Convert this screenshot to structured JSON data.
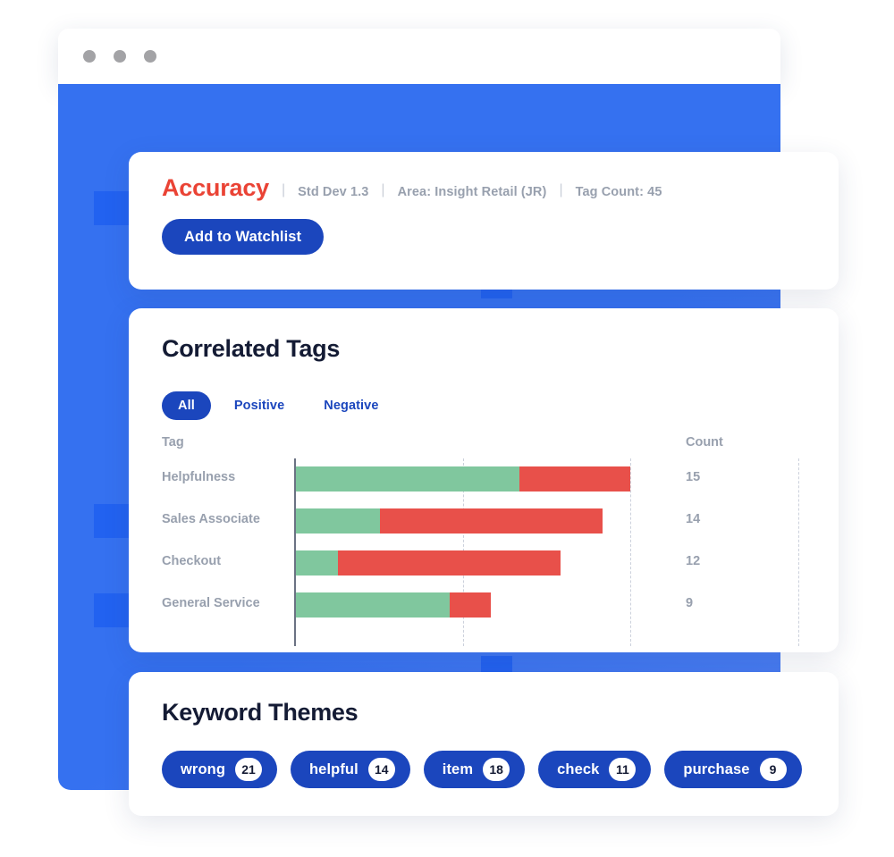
{
  "colors": {
    "panel_blue": "#3571f0",
    "accent_blue_dark": "#1e5ff0",
    "brand_blue": "#1b46bd",
    "metric_red": "#ea4335",
    "positive_green": "#80c79e",
    "negative_red": "#e8504a",
    "muted_text": "#98a0ae",
    "heading": "#141b34"
  },
  "window": {
    "traffic_lights": [
      "window-dot-close",
      "window-dot-minimize",
      "window-dot-maximize"
    ]
  },
  "summary": {
    "metric_title": "Accuracy",
    "separator": "|",
    "meta": [
      "Std Dev 1.3",
      "Area: Insight Retail (JR)",
      "Tag Count: 45"
    ],
    "watchlist_button": "Add to Watchlist"
  },
  "correlated_tags": {
    "title": "Correlated Tags",
    "tabs": [
      {
        "label": "All",
        "active": true
      },
      {
        "label": "Positive",
        "active": false
      },
      {
        "label": "Negative",
        "active": false
      }
    ],
    "columns": {
      "tag": "Tag",
      "count": "Count"
    }
  },
  "chart_data": {
    "type": "bar",
    "subtype": "stacked-horizontal",
    "title": "Correlated Tags",
    "xlabel": "",
    "ylabel": "Tag",
    "categories": [
      "Helpfulness",
      "Sales Associate",
      "Checkout",
      "General Service"
    ],
    "series": [
      {
        "name": "Positive",
        "color": "#80c79e",
        "values": [
          8,
          3,
          1.5,
          5.5
        ]
      },
      {
        "name": "Negative",
        "color": "#e8504a",
        "values": [
          4,
          8,
          8,
          1.5
        ]
      }
    ],
    "totals": [
      15,
      14,
      12,
      9
    ],
    "count_labels": [
      "15",
      "14",
      "12",
      "9"
    ],
    "xlim": [
      0,
      18
    ],
    "gridlines": [
      0,
      6,
      12,
      18
    ],
    "grid": true,
    "legend": "none"
  },
  "keyword_themes": {
    "title": "Keyword Themes",
    "chips": [
      {
        "label": "wrong",
        "count": "21"
      },
      {
        "label": "helpful",
        "count": "14"
      },
      {
        "label": "item",
        "count": "18"
      },
      {
        "label": "check",
        "count": "11"
      },
      {
        "label": "purchase",
        "count": "9"
      }
    ]
  }
}
